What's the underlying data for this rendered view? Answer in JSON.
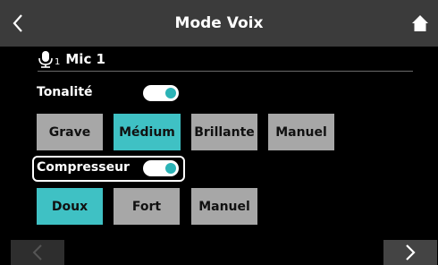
{
  "header": {
    "title": "Mode Voix",
    "back_icon": "chevron-left-icon",
    "home_icon": "home-icon"
  },
  "channel": {
    "icon": "microphone-icon",
    "sub_index": "1",
    "name": "Mic 1"
  },
  "tone": {
    "label": "Tonalité",
    "enabled": true,
    "options": [
      "Grave",
      "Médium",
      "Brillante",
      "Manuel"
    ],
    "selected": "Médium"
  },
  "compressor": {
    "label": "Compresseur",
    "enabled": true,
    "options": [
      "Doux",
      "Fort",
      "Manuel"
    ],
    "selected": "Doux"
  },
  "footer": {
    "prev_icon": "chevron-left-icon",
    "next_icon": "chevron-right-icon"
  },
  "colors": {
    "accent": "#3fc1c4",
    "button": "#a7a7a7",
    "header": "#3b3b3b",
    "background": "#000000"
  }
}
